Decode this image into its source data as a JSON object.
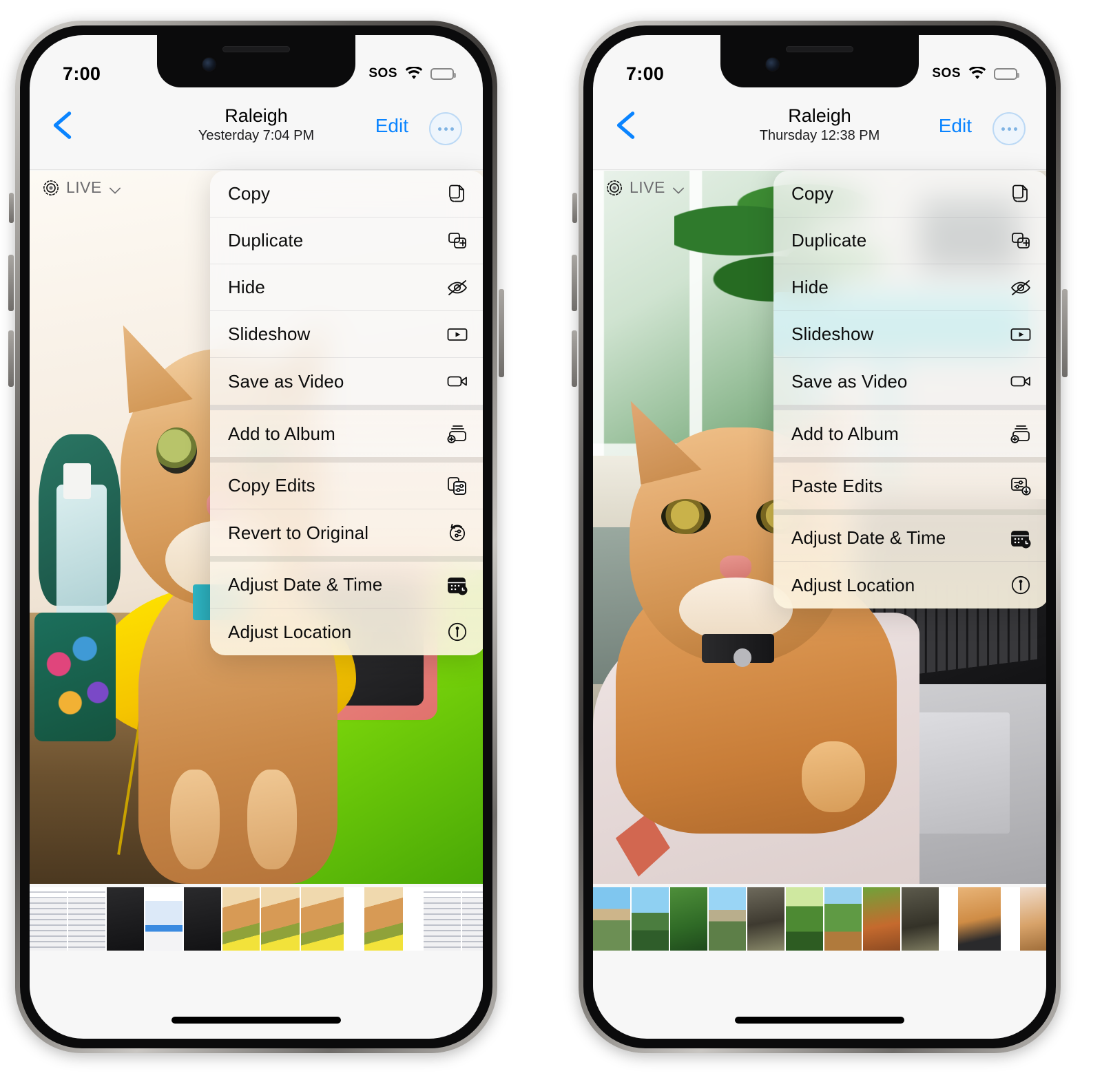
{
  "phones": [
    {
      "id": "left",
      "status": {
        "time": "7:00",
        "sos": "SOS",
        "wifi_icon": "wifi-icon",
        "battery_icon": "battery-icon"
      },
      "nav": {
        "back_icon": "chevron-left-icon",
        "title": "Raleigh",
        "subtitle": "Yesterday  7:04 PM",
        "edit_label": "Edit",
        "more_icon": "ellipsis-circle-icon"
      },
      "live_badge": {
        "label": "LIVE",
        "icon": "live-photo-icon",
        "chevron_icon": "chevron-down-icon"
      },
      "menu": {
        "groups": [
          {
            "items": [
              {
                "label": "Copy",
                "icon": "copy-icon"
              },
              {
                "label": "Duplicate",
                "icon": "duplicate-icon"
              },
              {
                "label": "Hide",
                "icon": "eye-slash-icon"
              },
              {
                "label": "Slideshow",
                "icon": "slideshow-icon"
              },
              {
                "label": "Save as Video",
                "icon": "video-camera-icon"
              }
            ]
          },
          {
            "items": [
              {
                "label": "Add to Album",
                "icon": "add-to-album-icon"
              }
            ]
          },
          {
            "items": [
              {
                "label": "Copy Edits",
                "icon": "copy-edits-icon"
              },
              {
                "label": "Revert to Original",
                "icon": "revert-icon"
              }
            ]
          },
          {
            "items": [
              {
                "label": "Adjust Date & Time",
                "icon": "calendar-clock-icon"
              },
              {
                "label": "Adjust Location",
                "icon": "location-pin-circle-icon"
              }
            ]
          }
        ]
      },
      "toolbar": [
        {
          "name": "share-button",
          "icon": "share-icon"
        },
        {
          "name": "favorite-button",
          "icon": "heart-icon"
        },
        {
          "name": "info-button",
          "icon": "info-sparkle-icon"
        },
        {
          "name": "delete-button",
          "icon": "trash-icon"
        }
      ]
    },
    {
      "id": "right",
      "status": {
        "time": "7:00",
        "sos": "SOS",
        "wifi_icon": "wifi-icon",
        "battery_icon": "battery-icon"
      },
      "nav": {
        "back_icon": "chevron-left-icon",
        "title": "Raleigh",
        "subtitle": "Thursday  12:38 PM",
        "edit_label": "Edit",
        "more_icon": "ellipsis-circle-icon"
      },
      "live_badge": {
        "label": "LIVE",
        "icon": "live-photo-icon",
        "chevron_icon": "chevron-down-icon"
      },
      "menu": {
        "groups": [
          {
            "items": [
              {
                "label": "Copy",
                "icon": "copy-icon"
              },
              {
                "label": "Duplicate",
                "icon": "duplicate-icon"
              },
              {
                "label": "Hide",
                "icon": "eye-slash-icon"
              },
              {
                "label": "Slideshow",
                "icon": "slideshow-icon"
              },
              {
                "label": "Save as Video",
                "icon": "video-camera-icon"
              }
            ]
          },
          {
            "items": [
              {
                "label": "Add to Album",
                "icon": "add-to-album-icon"
              }
            ]
          },
          {
            "items": [
              {
                "label": "Paste Edits",
                "icon": "paste-edits-icon"
              }
            ]
          },
          {
            "items": [
              {
                "label": "Adjust Date & Time",
                "icon": "calendar-clock-icon"
              },
              {
                "label": "Adjust Location",
                "icon": "location-pin-circle-icon"
              }
            ]
          }
        ]
      },
      "toolbar": [
        {
          "name": "share-button",
          "icon": "share-icon"
        },
        {
          "name": "favorite-button",
          "icon": "heart-icon"
        },
        {
          "name": "info-button",
          "icon": "info-sparkle-icon"
        },
        {
          "name": "delete-button",
          "icon": "trash-icon"
        }
      ]
    }
  ],
  "colors": {
    "accent": "#0a84ff",
    "menu_background": "#f9f9f9",
    "chrome_background": "#f7f7f7",
    "text_primary": "#0c0c0c",
    "text_secondary": "#6d6d70"
  }
}
